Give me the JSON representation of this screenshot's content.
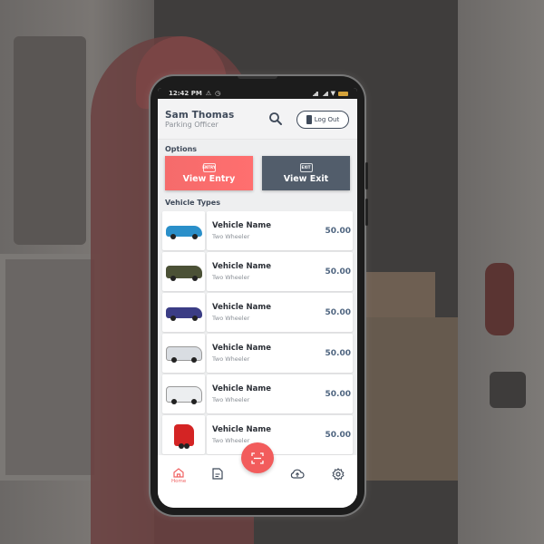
{
  "status_bar": {
    "time": "12:42 PM"
  },
  "header": {
    "user_name": "Sam Thomas",
    "user_role": "Parking Officer",
    "logout_label": "Log Out"
  },
  "options": {
    "section_label": "Options",
    "entry": {
      "label": "View Entry",
      "icon_text": "ENTRY"
    },
    "exit": {
      "label": "View Exit",
      "icon_text": "EXIT"
    }
  },
  "vehicle_types": {
    "section_label": "Vehicle Types",
    "items": [
      {
        "name": "Vehicle Name",
        "type": "Two Wheeler",
        "price": "50.00",
        "image": "car-image"
      },
      {
        "name": "Vehicle Name",
        "type": "Two Wheeler",
        "price": "50.00",
        "image": "jeep-image"
      },
      {
        "name": "Vehicle Name",
        "type": "Two Wheeler",
        "price": "50.00",
        "image": "cargo-trike-image"
      },
      {
        "name": "Vehicle Name",
        "type": "Two Wheeler",
        "price": "50.00",
        "image": "bus-image"
      },
      {
        "name": "Vehicle Name",
        "type": "Two Wheeler",
        "price": "50.00",
        "image": "truck-image"
      },
      {
        "name": "Vehicle Name",
        "type": "Two Wheeler",
        "price": "50.00",
        "image": "tuk-tuk-image"
      }
    ]
  },
  "bottom_nav": {
    "home_label": "Home"
  },
  "colors": {
    "accent": "#f25c5c",
    "dark": "#525d6b",
    "price": "#4f6580"
  }
}
